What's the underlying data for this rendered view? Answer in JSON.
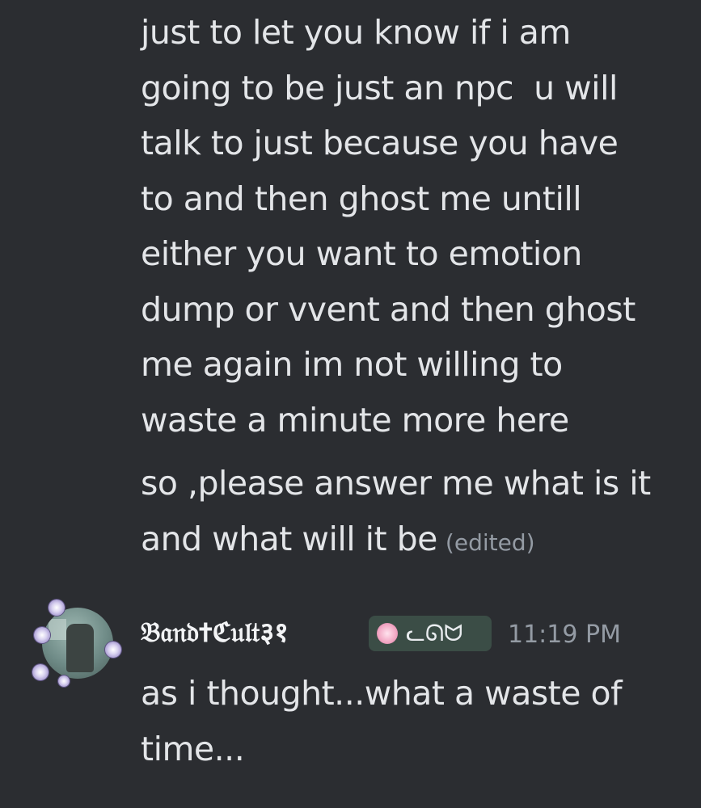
{
  "messages": {
    "previous": {
      "lines": [
        "just to let you know if i am",
        "going to be just an npc  u will",
        "talk to just because you have",
        "to and then ghost me untill",
        "either you want to emotion",
        "dump or vvent and then ghost",
        "me again im not willing to",
        "waste a minute more here"
      ],
      "followup_lines": [
        "so ,please answer me what is it",
        "and what will it be"
      ],
      "edited_label": "(edited)"
    },
    "reply": {
      "username": "𝔅𝔞𝔫𝔡✝ℭ𝔲𝔩𝔱३१",
      "tag_text": "ᓚᘏᗢ",
      "timestamp": "11:19 PM",
      "lines": [
        "as i thought...what a waste of",
        "time..."
      ]
    }
  },
  "colors": {
    "background": "#2b2d31",
    "text": "#e3e5e8",
    "muted": "#949ba4",
    "tag_bg": "#3b4d46"
  }
}
